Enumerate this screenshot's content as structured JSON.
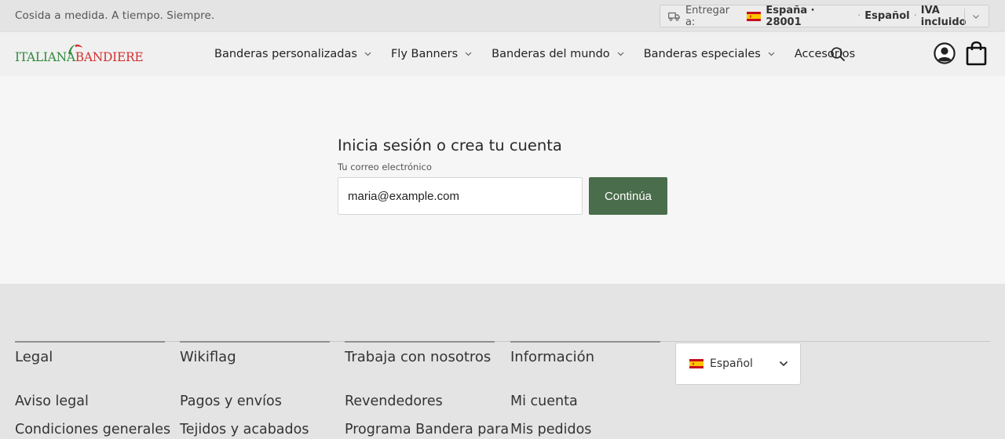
{
  "topbar": {
    "tagline": "Cosida a medida. A tiempo. Siempre.",
    "deliver": {
      "label": "Entregar a:",
      "country": "España · 28001",
      "language": "Español",
      "tax": "IVA incluido",
      "truck_icon": "truck-icon",
      "flag_icon": "spain-flag-icon"
    }
  },
  "header": {
    "logo": {
      "part1": "ITALIANA",
      "part2": "BANDIERE",
      "colors": {
        "green": "#2f8a3b",
        "red": "#d23232"
      }
    },
    "nav": [
      {
        "label": "Banderas personalizadas",
        "has_dropdown": true
      },
      {
        "label": "Fly Banners",
        "has_dropdown": true
      },
      {
        "label": "Banderas del mundo",
        "has_dropdown": true
      },
      {
        "label": "Banderas especiales",
        "has_dropdown": true
      },
      {
        "label": "Accesorios",
        "has_dropdown": false
      }
    ],
    "icons": [
      "search-icon",
      "account-icon",
      "shopping-bag-icon"
    ]
  },
  "login": {
    "title": "Inicia sesión o crea tu cuenta",
    "email_label": "Tu correo electrónico",
    "email_value": "maria@example.com",
    "continue_label": "Continúa",
    "accent_color": "#4a6d4c"
  },
  "footer": {
    "columns": [
      {
        "title": "Legal",
        "links": [
          "Aviso legal",
          "Condiciones generales"
        ]
      },
      {
        "title": "Wikiflag",
        "links": [
          "Pagos y envíos",
          "Tejidos y acabados"
        ]
      },
      {
        "title": "Trabaja con nosotros",
        "links": [
          "Revendedores",
          "Programa Bandera para"
        ]
      },
      {
        "title": "Información",
        "links": [
          "Mi cuenta",
          "Mis pedidos"
        ]
      }
    ],
    "language_selector": {
      "value": "Español",
      "flag_icon": "spain-flag-icon"
    }
  }
}
